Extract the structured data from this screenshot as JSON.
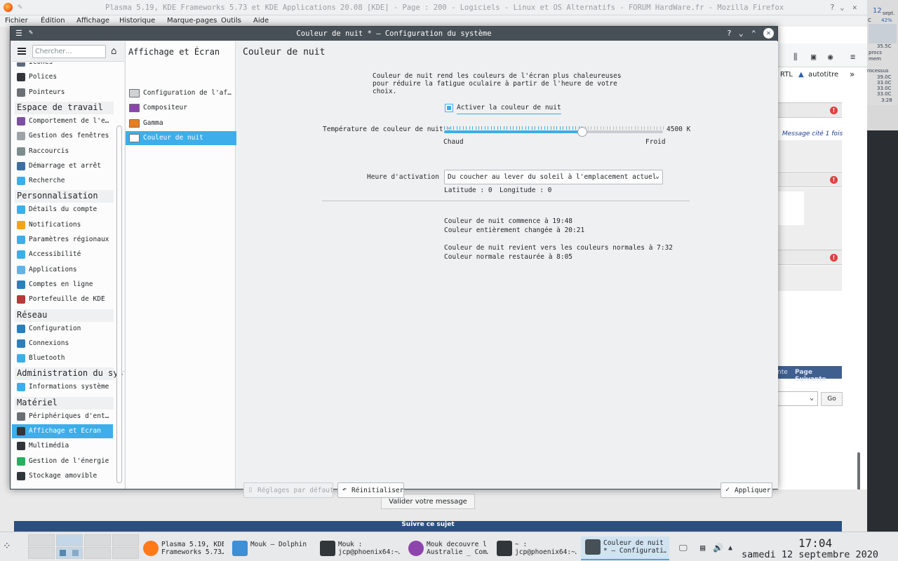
{
  "firefox": {
    "title": "Plasma 5.19, KDE Frameworks 5.73 et KDE Applications 20.08 [KDE] - Page : 200 - Logiciels - Linux et OS Alternatifs - FORUM HardWare.fr - Mozilla Firefox",
    "menu": [
      "Fichier",
      "Édition",
      "Affichage",
      "Historique",
      "Marque-pages",
      "Outils",
      "Aide"
    ],
    "bookmarks": [
      "RTL",
      "autotitre"
    ],
    "quote": "Message cité 1 fois",
    "page_next": "Page Suivante",
    "page_prev_partial": "nte",
    "go": "Go",
    "validate": "Valider votre message",
    "suivi": "Suivre ce sujet"
  },
  "conky": {
    "date_num": "12",
    "month": "sept.",
    "cpu_unit": "C",
    "cpu_pct": "42%",
    "temp1": "35.5C",
    "procs": "procs",
    "mem": "mem",
    "processus": "rocessus",
    "t1": "39.0C",
    "t2": "33.0C",
    "t3": "33.0C",
    "t4": "33.0C",
    "t5": "3:28"
  },
  "dialog": {
    "title": "Couleur de nuit * — Configuration du système",
    "search_placeholder": "Chercher…",
    "sidebar": [
      {
        "type": "item",
        "label": "Icônes",
        "color": "#5c6b7a"
      },
      {
        "type": "item",
        "label": "Polices",
        "color": "#31363b"
      },
      {
        "type": "item",
        "label": "Pointeurs",
        "color": "#6b7075"
      },
      {
        "type": "head",
        "label": "Espace de travail"
      },
      {
        "type": "item",
        "label": "Comportement de l'espace de travail",
        "color": "#7d4fa0"
      },
      {
        "type": "item",
        "label": "Gestion des fenêtres",
        "color": "#9ea3a8"
      },
      {
        "type": "item",
        "label": "Raccourcis",
        "color": "#7f8c8d"
      },
      {
        "type": "item",
        "label": "Démarrage et arrêt",
        "color": "#3f6f9f"
      },
      {
        "type": "item",
        "label": "Recherche",
        "color": "#3daee9"
      },
      {
        "type": "head",
        "label": "Personnalisation"
      },
      {
        "type": "item",
        "label": "Détails du compte",
        "color": "#3daee9"
      },
      {
        "type": "item",
        "label": "Notifications",
        "color": "#f6a21e"
      },
      {
        "type": "item",
        "label": "Paramètres régionaux",
        "color": "#3daee9"
      },
      {
        "type": "item",
        "label": "Accessibilité",
        "color": "#3daee9"
      },
      {
        "type": "item",
        "label": "Applications",
        "color": "#5fb4ea"
      },
      {
        "type": "item",
        "label": "Comptes en ligne",
        "color": "#2e7fb8"
      },
      {
        "type": "item",
        "label": "Portefeuille de KDE",
        "color": "#b53a3a"
      },
      {
        "type": "head",
        "label": "Réseau"
      },
      {
        "type": "item",
        "label": "Configuration",
        "color": "#2e7fb8"
      },
      {
        "type": "item",
        "label": "Connexions",
        "color": "#2e7fb8"
      },
      {
        "type": "item",
        "label": "Bluetooth",
        "color": "#3daee9"
      },
      {
        "type": "head",
        "label": "Administration du système"
      },
      {
        "type": "item",
        "label": "Informations système",
        "color": "#3daee9"
      },
      {
        "type": "head",
        "label": "Matériel"
      },
      {
        "type": "item",
        "label": "Périphériques d'entrée",
        "color": "#6b7075"
      },
      {
        "type": "item",
        "label": "Affichage et Écran",
        "color": "#31363b",
        "selected": true
      },
      {
        "type": "item",
        "label": "Multimédia",
        "color": "#31363b"
      },
      {
        "type": "item",
        "label": "Gestion de l'énergie",
        "color": "#27ae60"
      },
      {
        "type": "item",
        "label": "Stockage amovible",
        "color": "#31363b"
      }
    ],
    "subpanel": {
      "title": "Affichage et Écran",
      "items": [
        {
          "label": "Configuration de l'affichage",
          "color": "#cfd3d6"
        },
        {
          "label": "Compositeur",
          "color": "#8e44ad"
        },
        {
          "label": "Gamma",
          "color": "#e67e22"
        },
        {
          "label": "Couleur de nuit",
          "color": "#ffffff",
          "selected": true
        }
      ]
    },
    "main": {
      "title": "Couleur de nuit",
      "description": "Couleur de nuit rend les couleurs de l'écran plus chaleureuses pour réduire la fatigue oculaire à partir de l'heure de votre choix.",
      "enable_label": "Activer la couleur de nuit",
      "enabled": true,
      "temp_label": "Température de couleur de nuit :",
      "temp_value": "4500 K",
      "temp_fraction": 0.63,
      "warm": "Chaud",
      "cold": "Froid",
      "activation_label": "Heure d'activation :",
      "activation_value": "Du coucher au lever du soleil à l'emplacement actuel",
      "latitude": "Latitude : 0",
      "longitude": "Longitude : 0",
      "times": [
        "Couleur de nuit commence à 19:48",
        "Couleur entièrement changée à 20:21",
        "",
        "Couleur de nuit revient vers les couleurs normales à 7:32",
        "Couleur normale restaurée à 8:05"
      ]
    },
    "buttons": {
      "defaults": "Réglages par défaut",
      "reset": "Réinitialiser",
      "apply": "Appliquer"
    }
  },
  "taskbar": {
    "tasks": [
      {
        "label": "Plasma 5.19, KDE\nFrameworks 5.73…",
        "color": "#ff7a1a",
        "round": true
      },
      {
        "label": "Mouk — Dolphin",
        "color": "#3d8fd6",
        "round": false
      },
      {
        "label": "Mouk :\njcp@phoenix64:~…",
        "color": "#31363b",
        "round": false
      },
      {
        "label": "Mouk decouvre l\nAustralie _ Com…",
        "color": "#8e44ad",
        "round": true
      },
      {
        "label": "~ :\njcp@phoenix64:~…",
        "color": "#31363b",
        "round": false
      },
      {
        "label": "Couleur de nuit\n* — Configurati…",
        "color": "#475057",
        "round": false,
        "active": true
      }
    ],
    "time": "17:04",
    "date": "samedi 12 septembre 2020"
  }
}
